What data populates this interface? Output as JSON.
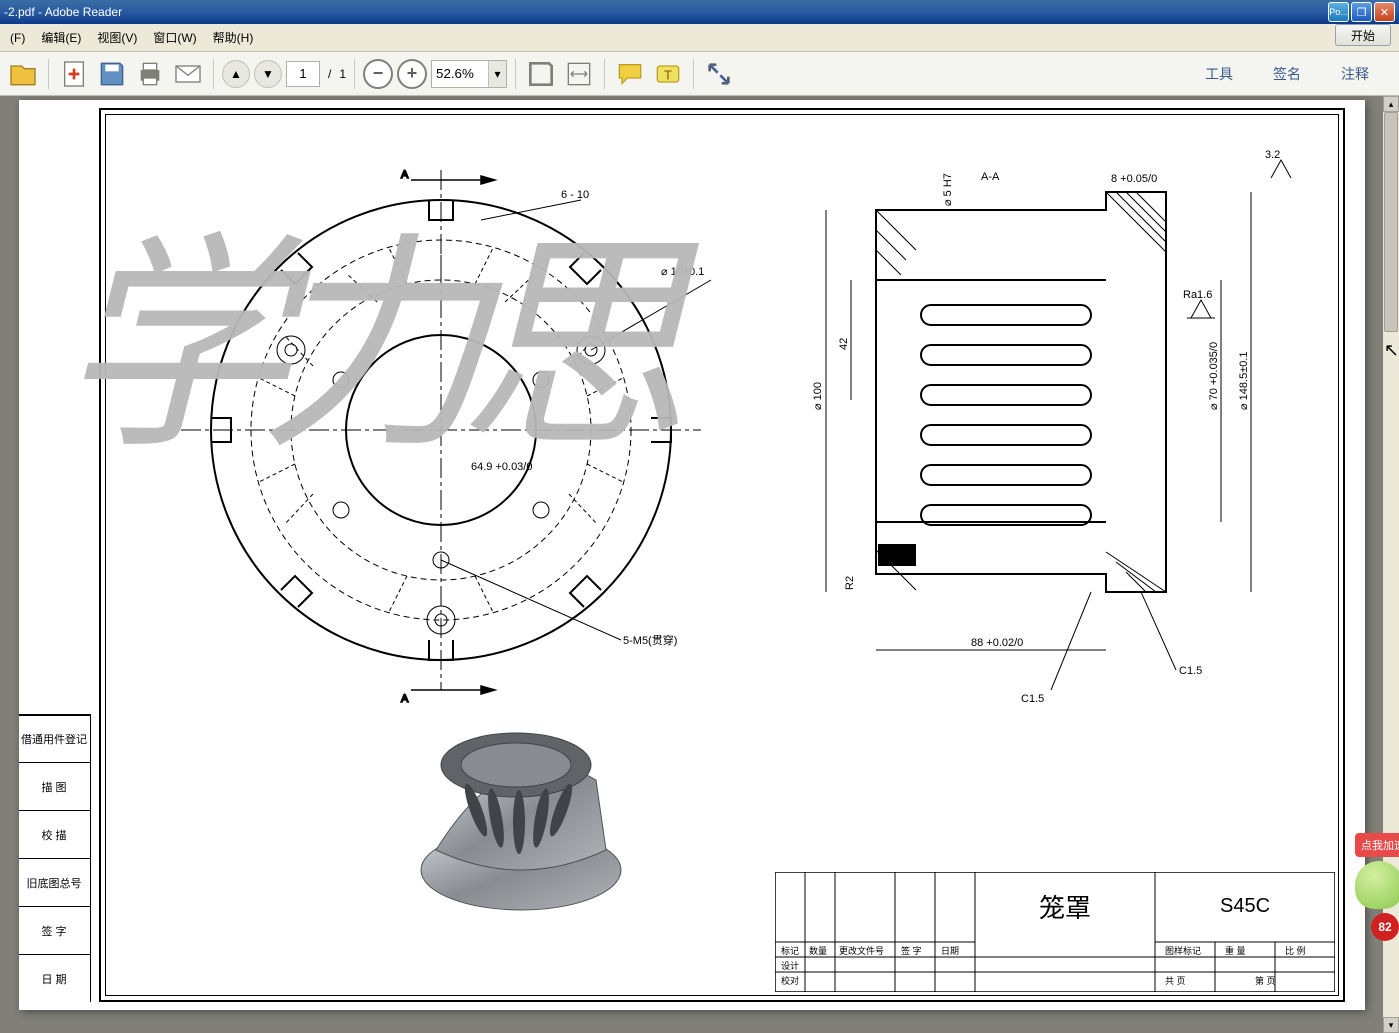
{
  "window": {
    "title": "-2.pdf - Adobe Reader",
    "min_label": "Po...",
    "start_label": "开始"
  },
  "menu": {
    "file": "(F)",
    "edit": "编辑(E)",
    "view": "视图(V)",
    "window": "窗口(W)",
    "help": "帮助(H)"
  },
  "toolbar": {
    "page_current": "1",
    "page_sep": "/",
    "page_total": "1",
    "zoom_value": "52.6%",
    "tools_label": "工具",
    "sign_label": "签名",
    "annotate_label": "注释"
  },
  "drawing": {
    "section_label": "A-A",
    "section_arrow_top": "A",
    "section_arrow_bottom": "A",
    "dim_hole_dia": "⌀ 10±0.1",
    "dim_slot": "6 - 10",
    "dim_bore": "64.9 +0.03/0",
    "dim_thread": "5-M5(贯穿)",
    "dim_pin": "⌀ 5 H7",
    "dim_top_thick": "8 +0.05/0",
    "dim_outer_dia": "⌀ 100",
    "dim_inner_h": "42",
    "dim_flange_dia": "⌀ 148.5±0.1",
    "dim_bore_dia": "⌀ 70 +0.035/0",
    "dim_length": "88 +0.02/0",
    "chamfer1": "C1.5",
    "chamfer2": "C1.5",
    "radius": "R2",
    "surface_finish": "3.2",
    "roughness": "Ra1.6"
  },
  "title_block": {
    "part_name": "笼罩",
    "material": "S45C",
    "row_mark": "标记",
    "row_qty": "数量",
    "row_changedoc": "更改文件号",
    "row_sign": "签 字",
    "row_date": "日期",
    "row_design": "设计",
    "row_check": "校对",
    "row_drawmark": "图样标记",
    "row_weight": "重 量",
    "row_scale": "比 例",
    "row_共": "共 页",
    "row_第": "第 页"
  },
  "side_labels": {
    "r1": "借通用件登记",
    "r2": "描 图",
    "r3": "校 描",
    "r4": "旧底图总号",
    "r5": "签 字",
    "r6": "日 期"
  },
  "widget": {
    "bubble": "点我加速",
    "badge": "82"
  }
}
